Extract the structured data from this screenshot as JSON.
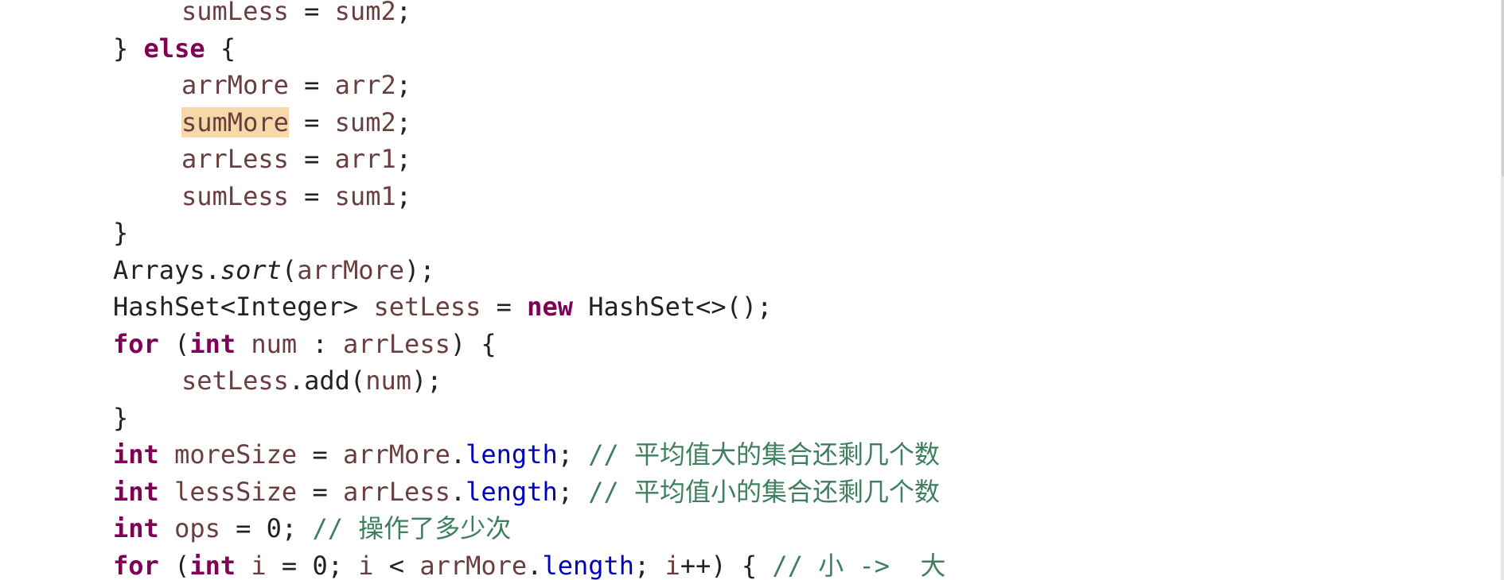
{
  "editor": {
    "lines": [
      {
        "indent": 1,
        "tokens": [
          {
            "t": "sumLess",
            "c": "var"
          },
          {
            "t": " = ",
            "c": "plain"
          },
          {
            "t": "sum2",
            "c": "var"
          },
          {
            "t": ";",
            "c": "plain"
          }
        ]
      },
      {
        "indent": 0,
        "tokens": [
          {
            "t": "} ",
            "c": "plain"
          },
          {
            "t": "else",
            "c": "kw"
          },
          {
            "t": " {",
            "c": "plain"
          }
        ]
      },
      {
        "indent": 1,
        "tokens": [
          {
            "t": "arrMore",
            "c": "var"
          },
          {
            "t": " = ",
            "c": "plain"
          },
          {
            "t": "arr2",
            "c": "var"
          },
          {
            "t": ";",
            "c": "plain"
          }
        ]
      },
      {
        "indent": 1,
        "tokens": [
          {
            "t": "sumMore",
            "c": "var hl"
          },
          {
            "t": " = ",
            "c": "plain"
          },
          {
            "t": "sum2",
            "c": "var"
          },
          {
            "t": ";",
            "c": "plain"
          }
        ]
      },
      {
        "indent": 1,
        "tokens": [
          {
            "t": "arrLess",
            "c": "var"
          },
          {
            "t": " = ",
            "c": "plain"
          },
          {
            "t": "arr1",
            "c": "var"
          },
          {
            "t": ";",
            "c": "plain"
          }
        ]
      },
      {
        "indent": 1,
        "tokens": [
          {
            "t": "sumLess",
            "c": "var"
          },
          {
            "t": " = ",
            "c": "plain"
          },
          {
            "t": "sum1",
            "c": "var"
          },
          {
            "t": ";",
            "c": "plain"
          }
        ]
      },
      {
        "indent": 0,
        "tokens": [
          {
            "t": "}",
            "c": "plain"
          }
        ]
      },
      {
        "indent": 0,
        "tokens": [
          {
            "t": "Arrays.",
            "c": "plain"
          },
          {
            "t": "sort",
            "c": "static"
          },
          {
            "t": "(",
            "c": "plain"
          },
          {
            "t": "arrMore",
            "c": "var"
          },
          {
            "t": ");",
            "c": "plain"
          }
        ]
      },
      {
        "indent": 0,
        "tokens": [
          {
            "t": "HashSet<Integer> ",
            "c": "plain"
          },
          {
            "t": "setLess",
            "c": "var"
          },
          {
            "t": " = ",
            "c": "plain"
          },
          {
            "t": "new",
            "c": "kw"
          },
          {
            "t": " HashSet<>();",
            "c": "plain"
          }
        ]
      },
      {
        "indent": 0,
        "tokens": [
          {
            "t": "for",
            "c": "kw"
          },
          {
            "t": " (",
            "c": "plain"
          },
          {
            "t": "int",
            "c": "kw"
          },
          {
            "t": " ",
            "c": "plain"
          },
          {
            "t": "num",
            "c": "var"
          },
          {
            "t": " : ",
            "c": "plain"
          },
          {
            "t": "arrLess",
            "c": "var"
          },
          {
            "t": ") {",
            "c": "plain"
          }
        ]
      },
      {
        "indent": 1,
        "tokens": [
          {
            "t": "setLess",
            "c": "var"
          },
          {
            "t": ".add(",
            "c": "plain"
          },
          {
            "t": "num",
            "c": "var"
          },
          {
            "t": ");",
            "c": "plain"
          }
        ]
      },
      {
        "indent": 0,
        "tokens": [
          {
            "t": "}",
            "c": "plain"
          }
        ]
      },
      {
        "indent": 0,
        "tokens": [
          {
            "t": "int",
            "c": "kw"
          },
          {
            "t": " ",
            "c": "plain"
          },
          {
            "t": "moreSize",
            "c": "var"
          },
          {
            "t": " = ",
            "c": "plain"
          },
          {
            "t": "arrMore",
            "c": "var"
          },
          {
            "t": ".",
            "c": "plain"
          },
          {
            "t": "length",
            "c": "field"
          },
          {
            "t": "; ",
            "c": "plain"
          },
          {
            "t": "// 平均值大的集合还剩几个数",
            "c": "cmt"
          }
        ]
      },
      {
        "indent": 0,
        "tokens": [
          {
            "t": "int",
            "c": "kw"
          },
          {
            "t": " ",
            "c": "plain"
          },
          {
            "t": "lessSize",
            "c": "var"
          },
          {
            "t": " = ",
            "c": "plain"
          },
          {
            "t": "arrLess",
            "c": "var"
          },
          {
            "t": ".",
            "c": "plain"
          },
          {
            "t": "length",
            "c": "field"
          },
          {
            "t": "; ",
            "c": "plain"
          },
          {
            "t": "// 平均值小的集合还剩几个数",
            "c": "cmt"
          }
        ]
      },
      {
        "indent": 0,
        "tokens": [
          {
            "t": "int",
            "c": "kw"
          },
          {
            "t": " ",
            "c": "plain"
          },
          {
            "t": "ops",
            "c": "var"
          },
          {
            "t": " = 0; ",
            "c": "plain"
          },
          {
            "t": "// 操作了多少次",
            "c": "cmt"
          }
        ]
      },
      {
        "indent": 0,
        "tokens": [
          {
            "t": "for",
            "c": "kw"
          },
          {
            "t": " (",
            "c": "plain"
          },
          {
            "t": "int",
            "c": "kw"
          },
          {
            "t": " ",
            "c": "plain"
          },
          {
            "t": "i",
            "c": "var"
          },
          {
            "t": " = 0; ",
            "c": "plain"
          },
          {
            "t": "i",
            "c": "var"
          },
          {
            "t": " < ",
            "c": "plain"
          },
          {
            "t": "arrMore",
            "c": "var"
          },
          {
            "t": ".",
            "c": "plain"
          },
          {
            "t": "length",
            "c": "field"
          },
          {
            "t": "; ",
            "c": "plain"
          },
          {
            "t": "i",
            "c": "var"
          },
          {
            "t": "++) { ",
            "c": "plain"
          },
          {
            "t": "// 小 ->  大",
            "c": "cmt"
          }
        ]
      }
    ]
  }
}
